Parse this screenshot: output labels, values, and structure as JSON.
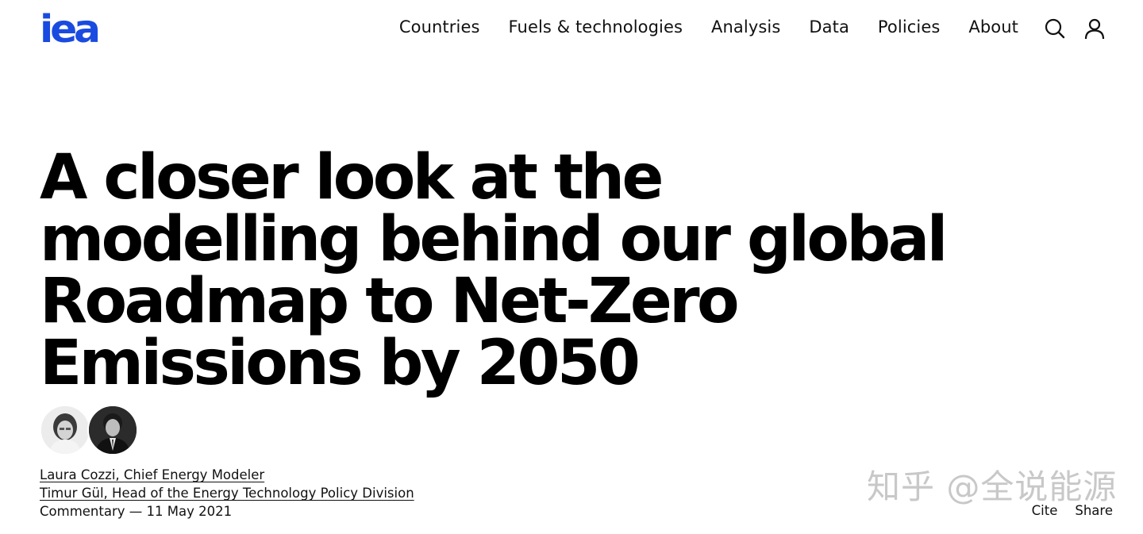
{
  "header": {
    "logo_text": "iea",
    "brand_color": "#1a4be0",
    "nav": [
      {
        "label": "Countries"
      },
      {
        "label": "Fuels & technologies"
      },
      {
        "label": "Analysis"
      },
      {
        "label": "Data"
      },
      {
        "label": "Policies"
      },
      {
        "label": "About"
      }
    ],
    "icons": [
      "search-icon",
      "user-icon"
    ]
  },
  "article": {
    "title": "A closer look at the modelling behind our global Roadmap to Net-Zero Emissions by 2050",
    "authors": [
      {
        "text": "Laura Cozzi, Chief Energy Modeler"
      },
      {
        "text": "Timur Gül, Head of the Energy Technology Policy Division"
      }
    ],
    "meta": "Commentary — 11 May 2021"
  },
  "actions": {
    "cite_label": "Cite",
    "share_label": "Share"
  },
  "watermark": "知乎 @全说能源"
}
